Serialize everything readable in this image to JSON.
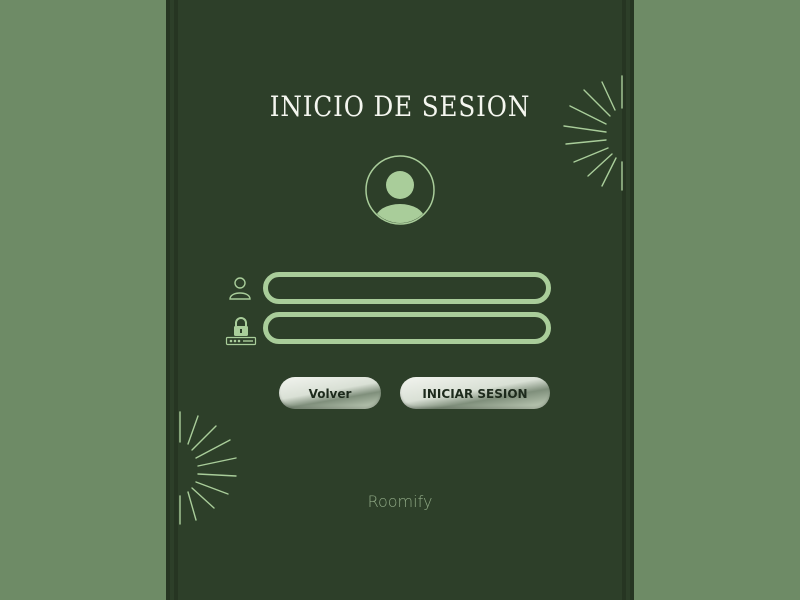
{
  "login": {
    "title": "INICIO DE SESION",
    "username": {
      "icon": "user-icon",
      "value": ""
    },
    "password": {
      "icon": "lock-password-icon",
      "value": ""
    },
    "buttons": {
      "back_label": "Volver",
      "login_label": "INICIAR SESION"
    },
    "brand": "Roomify"
  },
  "colors": {
    "background": "#6e8b66",
    "panel": "#2d3f29",
    "accent": "#a9cd9a",
    "title_text": "#f4f6ef"
  },
  "icons": {
    "avatar": "user-avatar-icon",
    "decoration": "sunburst-lines"
  }
}
